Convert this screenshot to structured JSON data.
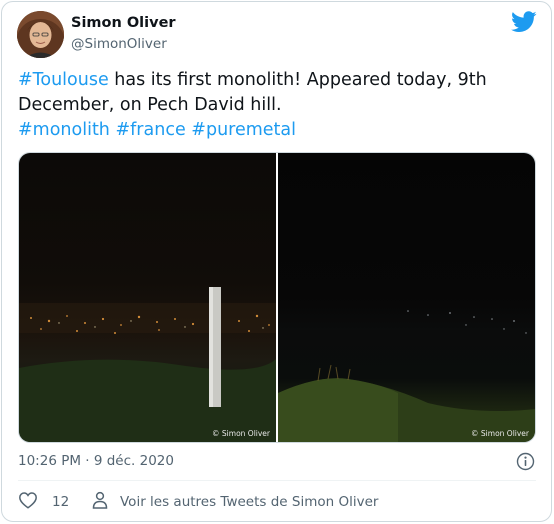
{
  "tweet": {
    "author_name": "Simon Oliver",
    "author_handle": "@SimonOliver",
    "text_parts": {
      "hashtag_1": "#Toulouse",
      "line_1_rest": " has its first monolith! Appeared today, 9th",
      "line_2": "December, on Pech David hill.",
      "hashtag_2": "#monolith",
      "hashtag_3": "#france",
      "hashtag_4": "#puremetal"
    },
    "photos": [
      {
        "credit": "© Simon Oliver"
      },
      {
        "credit": "© Simon Oliver"
      }
    ],
    "timestamp": "10:26 PM · 9 déc. 2020",
    "like_count": "12",
    "more_tweets_label": "Voir les autres Tweets de Simon Oliver"
  },
  "icons": {
    "brand": "twitter-bird-icon",
    "like": "heart-icon",
    "person": "person-icon",
    "info": "info-icon"
  },
  "colors": {
    "accent": "#1d9bf0",
    "text": "#0f1419",
    "secondary": "#536471",
    "border": "#cfd9de"
  }
}
